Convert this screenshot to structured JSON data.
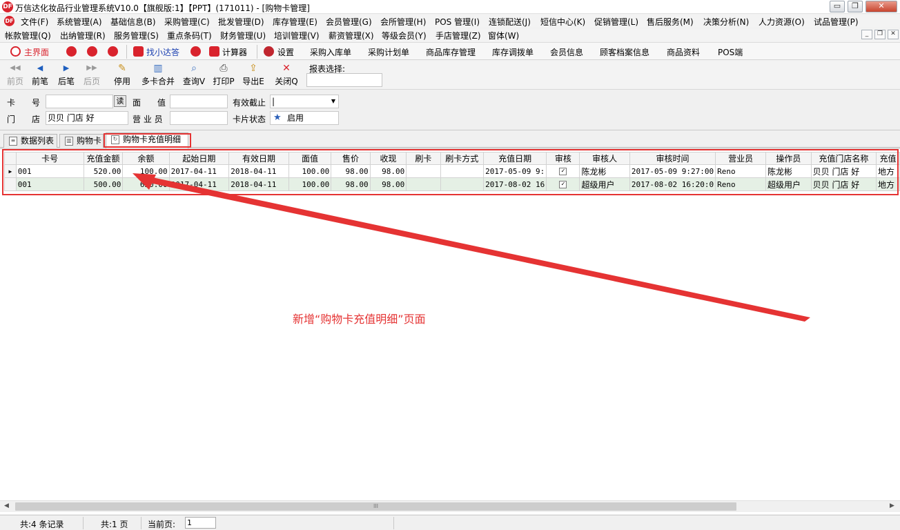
{
  "window": {
    "title": "万信达化妆品行业管理系统V10.0【旗舰版:1】【PPT】(171011) - [购物卡管理]",
    "logo_text": "DF",
    "controls": {
      "minimize": "▭",
      "restore": "❐",
      "close": "✕"
    }
  },
  "menu": {
    "row1": [
      "文件(F)",
      "系统管理(A)",
      "基础信息(B)",
      "采购管理(C)",
      "批发管理(D)",
      "库存管理(E)",
      "会员管理(G)",
      "会所管理(H)",
      "POS 管理(I)",
      "连锁配送(J)",
      "短信中心(K)",
      "促销管理(L)",
      "售后服务(M)",
      "决策分析(N)",
      "人力资源(O)",
      "试品管理(P)"
    ],
    "row2": [
      "帐款管理(Q)",
      "出纳管理(R)",
      "服务管理(S)",
      "重点条码(T)",
      "财务管理(U)",
      "培训管理(V)",
      "薪资管理(X)",
      "等级会员(Y)",
      "手店管理(Z)",
      "窗体(W)"
    ],
    "mdi_controls": {
      "minimize": "_",
      "restore": "❐",
      "close": "✕"
    }
  },
  "quickbar": {
    "items": [
      "主界面",
      "找小达答",
      "计算器",
      "设置",
      "采购入库单",
      "采购计划单",
      "商品库存管理",
      "库存调拨单",
      "会员信息",
      "顾客档案信息",
      "商品资料",
      "POS端"
    ]
  },
  "toolbar": {
    "buttons": [
      {
        "label": "前页",
        "icon": "◀◀"
      },
      {
        "label": "前笔",
        "icon": "◀"
      },
      {
        "label": "后笔",
        "icon": "▶"
      },
      {
        "label": "后页",
        "icon": "▶▶"
      },
      {
        "label": "停用",
        "icon": "✎"
      },
      {
        "label": "多卡合并",
        "icon": "▥"
      },
      {
        "label": "查询V",
        "icon": "⌕"
      },
      {
        "label": "打印P",
        "icon": "⎙"
      },
      {
        "label": "导出E",
        "icon": "⇪"
      },
      {
        "label": "关闭Q",
        "icon": "✕"
      }
    ],
    "report_select_label": "报表选择:"
  },
  "filter": {
    "card_no_label": "卡　　号",
    "read_btn": "读",
    "face_value_label": "面　　值",
    "valid_until_label": "有效截止",
    "valid_until_value": "|",
    "store_label": "门　　店",
    "store_value": "贝贝 门店 好",
    "salesman_label": "营 业 员",
    "card_status_label": "卡片状态",
    "card_status_value": "启用"
  },
  "tabs": [
    "数据列表",
    "购物卡",
    "购物卡充值明细"
  ],
  "grid": {
    "columns": [
      "卡号",
      "充值金额",
      "余额",
      "起始日期",
      "有效日期",
      "面值",
      "售价",
      "收现",
      "刷卡",
      "刷卡方式",
      "充值日期",
      "审核",
      "审核人",
      "审核时间",
      "营业员",
      "操作员",
      "充值门店名称",
      "充值"
    ],
    "rows": [
      {
        "indicator": "▶",
        "cells": [
          "001",
          "520.00",
          "100.00",
          "2017-04-11",
          "2018-04-11",
          "100.00",
          "98.00",
          "98.00",
          "",
          "",
          "2017-05-09 9:",
          "✓",
          "陈龙彬",
          "2017-05-09 9:27:00",
          "Reno",
          "陈龙彬",
          "贝贝 门店 好",
          "地方"
        ]
      },
      {
        "indicator": "",
        "cells": [
          "001",
          "500.00",
          "620.00",
          "2017-04-11",
          "2018-04-11",
          "100.00",
          "98.00",
          "98.00",
          "",
          "",
          "2017-08-02 16",
          "✓",
          "超级用户",
          "2017-08-02 16:20:0",
          "Reno",
          "超级用户",
          "贝贝 门店 好",
          "地方"
        ]
      }
    ]
  },
  "scrollbar": {
    "left": "◀",
    "right": "▶",
    "grip": "III"
  },
  "status": {
    "records": "共:4 条记录",
    "pages": "共:1 页",
    "current_page_label": "当前页:",
    "current_page_value": "1"
  },
  "annotation": {
    "text": "新增“购物卡充值明细”页面",
    "color": "#e53333"
  }
}
